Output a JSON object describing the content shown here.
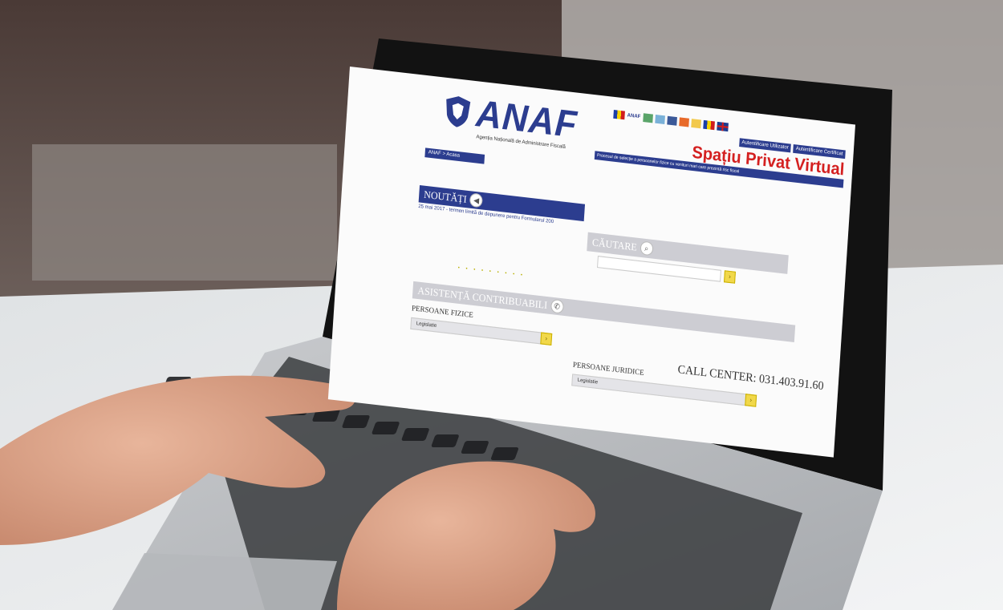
{
  "screen": {
    "logo": {
      "name": "ANAF",
      "agency": "Agenția Națională de Administrare Fiscală"
    },
    "breadcrumb": "ANAF > Acasa",
    "top": {
      "anaf_brand": "ANAF",
      "buttons": [
        "Autentificare Utilizator",
        "Autentificare Certificat"
      ],
      "spv": "Spațiu Privat Virtual",
      "notice": "Procesul de selecție a persoanelor fizice cu venituri mari care prezintă risc fiscal"
    },
    "news": {
      "title": "NOUTĂȚI",
      "item": "25 mai 2017 - termen limită de depunere pentru Formularul 200"
    },
    "search": {
      "title": "CĂUTARE"
    },
    "help": {
      "title": "ASISTENȚĂ CONTRIBUABILI"
    },
    "pf": {
      "title": "PERSOANE FIZICE",
      "select": "Legislatie"
    },
    "pj": {
      "title": "PERSOANE JURIDICE",
      "select": "Legislatie"
    },
    "call_center": "CALL CENTER: 031.403.91.60",
    "pager_dots": "• • • • • • • • •"
  },
  "colors": {
    "brand_blue": "#2c3d8f",
    "spv_red": "#d42020",
    "panel_grey": "#cdcdd3"
  }
}
